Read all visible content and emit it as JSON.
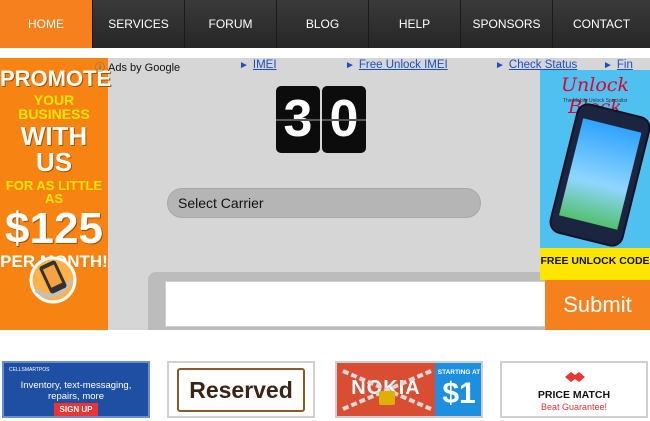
{
  "nav": {
    "items": [
      {
        "label": "HOME",
        "active": true
      },
      {
        "label": "SERVICES"
      },
      {
        "label": "FORUM"
      },
      {
        "label": "BLOG"
      },
      {
        "label": "HELP"
      },
      {
        "label": "SPONSORS"
      },
      {
        "label": "CONTACT"
      }
    ],
    "active_color": "#f7801e"
  },
  "left_ad": {
    "line1": "PROMOTE",
    "line2": "YOUR BUSINESS",
    "line3": "WITH US",
    "line4": "FOR AS LITTLE AS",
    "line5": "$125",
    "line6": "PER MONTH!",
    "icon": "phone-badge-icon"
  },
  "ads": {
    "ads_by": "Ads by Google",
    "info_icon": "info-icon",
    "links": [
      "IMEI",
      "Free Unlock IMEI",
      "Check Status",
      "Fin"
    ]
  },
  "countdown": {
    "digits": [
      "3",
      "0"
    ]
  },
  "form": {
    "carrier_label": "Select Carrier",
    "imei_placeholder": "",
    "submit_label": "Submit",
    "submit_color": "#f7801e"
  },
  "right_ad": {
    "title": "Unlock Block",
    "subtitle": "The Mobile Unlock Specialist",
    "cta": "FREE UNLOCK CODE"
  },
  "bottom_banners": {
    "cellsmartpos": {
      "logo": "CELLSMARTPOS",
      "text": "Inventory, text-messaging, repairs, more",
      "button": "SIGN UP"
    },
    "reserved": {
      "label": "Reserved"
    },
    "nokia": {
      "brand": "NOKIA",
      "starting": "STARTING AT",
      "price": "$1"
    },
    "price_match": {
      "title": "PRICE MATCH",
      "subtitle": "Beat Guarantee!",
      "icon": "handshake-icon"
    }
  }
}
